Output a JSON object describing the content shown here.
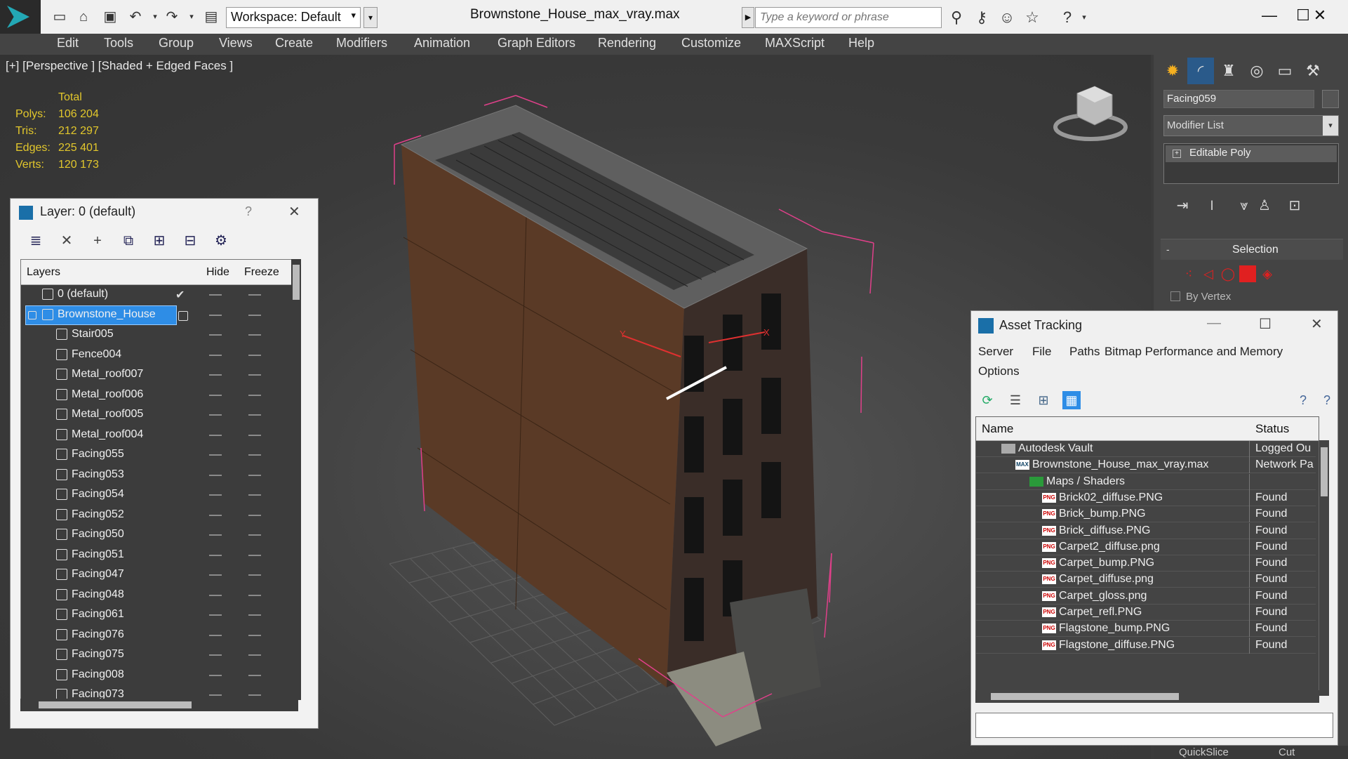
{
  "titlebar": {
    "workspace": "Workspace: Default",
    "document_title": "Brownstone_House_max_vray.max",
    "search_placeholder": "Type a keyword or phrase"
  },
  "menu": [
    "Edit",
    "Tools",
    "Group",
    "Views",
    "Create",
    "Modifiers",
    "Animation",
    "Graph Editors",
    "Rendering",
    "Customize",
    "MAXScript",
    "Help"
  ],
  "viewport": {
    "label": "[+] [Perspective ] [Shaded + Edged Faces ]",
    "stats": {
      "header": "Total",
      "rows": [
        {
          "label": "Polys:",
          "value": "106 204"
        },
        {
          "label": "Tris:",
          "value": "212 297"
        },
        {
          "label": "Edges:",
          "value": "225 401"
        },
        {
          "label": "Verts:",
          "value": "120 173"
        }
      ]
    },
    "axis_y": "Y",
    "axis_x": "X"
  },
  "layer_panel": {
    "title": "Layer: 0 (default)",
    "help": "?",
    "columns": {
      "layers": "Layers",
      "hide": "Hide",
      "freeze": "Freeze"
    },
    "rows": [
      {
        "name": "0 (default)",
        "type": "layer",
        "indent": 1
      },
      {
        "name": "Brownstone_House",
        "type": "layer",
        "indent": 1,
        "selected": true
      },
      {
        "name": "Stair005",
        "type": "object",
        "indent": 2
      },
      {
        "name": "Fence004",
        "type": "object",
        "indent": 2
      },
      {
        "name": "Metal_roof007",
        "type": "object",
        "indent": 2
      },
      {
        "name": "Metal_roof006",
        "type": "object",
        "indent": 2
      },
      {
        "name": "Metal_roof005",
        "type": "object",
        "indent": 2
      },
      {
        "name": "Metal_roof004",
        "type": "object",
        "indent": 2
      },
      {
        "name": "Facing055",
        "type": "object",
        "indent": 2
      },
      {
        "name": "Facing053",
        "type": "object",
        "indent": 2
      },
      {
        "name": "Facing054",
        "type": "object",
        "indent": 2
      },
      {
        "name": "Facing052",
        "type": "object",
        "indent": 2
      },
      {
        "name": "Facing050",
        "type": "object",
        "indent": 2
      },
      {
        "name": "Facing051",
        "type": "object",
        "indent": 2
      },
      {
        "name": "Facing047",
        "type": "object",
        "indent": 2
      },
      {
        "name": "Facing048",
        "type": "object",
        "indent": 2
      },
      {
        "name": "Facing061",
        "type": "object",
        "indent": 2
      },
      {
        "name": "Facing076",
        "type": "object",
        "indent": 2
      },
      {
        "name": "Facing075",
        "type": "object",
        "indent": 2
      },
      {
        "name": "Facing008",
        "type": "object",
        "indent": 2
      },
      {
        "name": "Facing073",
        "type": "object",
        "indent": 2
      }
    ]
  },
  "command_panel": {
    "object_name": "Facing059",
    "modifier_list": "Modifier List",
    "stack_item": "Editable Poly",
    "selection_title": "Selection",
    "by_vertex": "By Vertex",
    "quickslice": "QuickSlice",
    "cut": "Cut"
  },
  "asset_tracking": {
    "title": "Asset Tracking",
    "menu": [
      "Server",
      "File",
      "Paths",
      "Bitmap Performance and Memory",
      "Options"
    ],
    "columns": {
      "name": "Name",
      "status": "Status"
    },
    "rows": [
      {
        "name": "Autodesk Vault",
        "status": "Logged Ou",
        "kind": "vault"
      },
      {
        "name": "Brownstone_House_max_vray.max",
        "status": "Network Pa",
        "kind": "max"
      },
      {
        "name": "Maps / Shaders",
        "status": "",
        "kind": "folder"
      },
      {
        "name": "Brick02_diffuse.PNG",
        "status": "Found",
        "kind": "png"
      },
      {
        "name": "Brick_bump.PNG",
        "status": "Found",
        "kind": "png"
      },
      {
        "name": "Brick_diffuse.PNG",
        "status": "Found",
        "kind": "png"
      },
      {
        "name": "Carpet2_diffuse.png",
        "status": "Found",
        "kind": "png"
      },
      {
        "name": "Carpet_bump.PNG",
        "status": "Found",
        "kind": "png"
      },
      {
        "name": "Carpet_diffuse.png",
        "status": "Found",
        "kind": "png"
      },
      {
        "name": "Carpet_gloss.png",
        "status": "Found",
        "kind": "png"
      },
      {
        "name": "Carpet_refl.PNG",
        "status": "Found",
        "kind": "png"
      },
      {
        "name": "Flagstone_bump.PNG",
        "status": "Found",
        "kind": "png"
      },
      {
        "name": "Flagstone_diffuse.PNG",
        "status": "Found",
        "kind": "png"
      }
    ]
  }
}
